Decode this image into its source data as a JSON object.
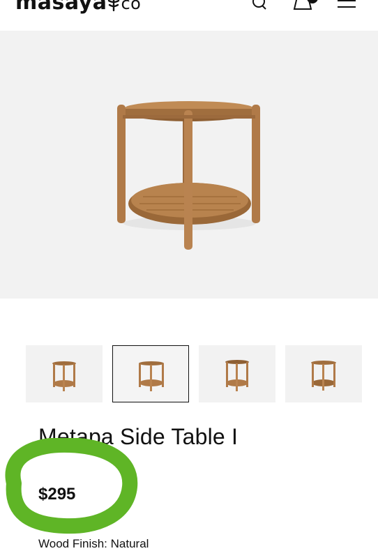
{
  "header": {
    "brand_main": "masaya",
    "brand_suffix": "co",
    "icons": [
      "search-icon",
      "shopping-bag-icon",
      "hamburger-menu-icon"
    ]
  },
  "gallery": {
    "thumbnails": [
      "side-table-view-1",
      "side-table-view-2",
      "side-table-view-3",
      "side-table-view-4"
    ],
    "selected_index": 1
  },
  "product": {
    "name": "Metapa Side Table I",
    "price": "$295",
    "wood_finish": "Wood Finish: Natural"
  },
  "colors": {
    "image_background": "#f2f2f2",
    "wood": "#b07a48",
    "highlight_marker": "#5fb526"
  }
}
